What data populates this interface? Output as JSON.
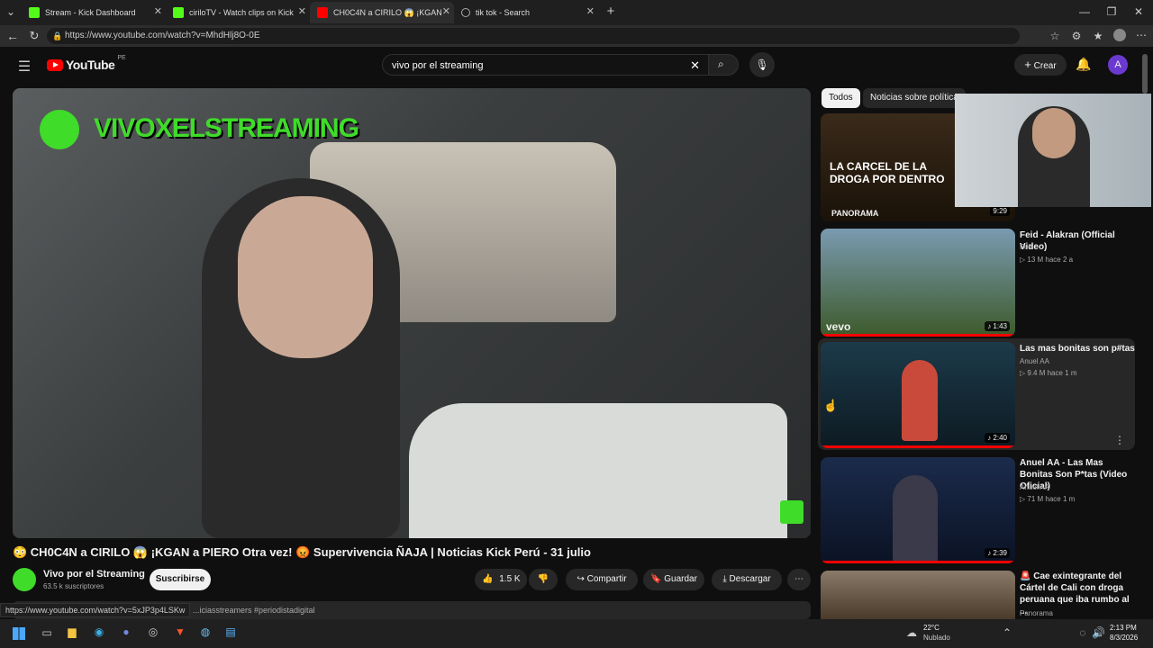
{
  "browser": {
    "tabs": [
      {
        "title": "Stream - Kick Dashboard"
      },
      {
        "title": "ciriloTV - Watch clips on Kick"
      },
      {
        "title": "CH0C4N a CIRILO 😱 ¡KGAN a"
      },
      {
        "title": "tik tok - Search"
      }
    ],
    "url": "https://www.youtube.com/watch?v=MhdHlj8O-0E",
    "status_url": "https://www.youtube.com/watch?v=5xJP3p4LSKw"
  },
  "yt": {
    "logo_text": "YouTube",
    "region": "PE",
    "search_value": "vivo por el streaming",
    "create_label": "Crear",
    "avatar_letter": "A"
  },
  "video": {
    "overlay_text": "VIVOXELSTREAMING",
    "title": "😳 CH0C4N a CIRILO 😱 ¡KGAN a PIERO Otra vez! 😡 Supervivencia ÑAJA | Noticias Kick Perú - 31 julio",
    "channel": "Vivo por el Streaming",
    "subscribers": "63.5 k suscriptores",
    "subscribe_label": "Suscribirse",
    "likes": "1.5 K",
    "share_label": "Compartir",
    "save_label": "Guardar",
    "download_label": "Descargar",
    "hashtags": "...iciasstreamers #periodistadigital"
  },
  "sidebar": {
    "chips": [
      "Todos",
      "Noticias sobre política"
    ],
    "items": [
      {
        "thumb_text": "LA CARCEL DE LA DROGA POR DENTRO",
        "brand": "PANORAMA",
        "duration": "9:29"
      },
      {
        "title": "Feid - Alakran (Official Video)",
        "channel": "Feid",
        "meta": "▷ 13 M  hace 2 a",
        "duration": "♪ 1:43",
        "brand": "vevo"
      },
      {
        "title": "Las mas bonitas son p#tas",
        "channel": "Anuel AA",
        "meta": "▷ 9.4 M  hace 1 m",
        "duration": "♪ 2:40"
      },
      {
        "title": "Anuel AA - Las Mas Bonitas Son P*tas (Video Oficial)",
        "channel": "Anuel AA",
        "meta": "▷ 71 M  hace 1 m",
        "duration": "♪ 2:39"
      },
      {
        "title": "🚨 Cae exintegrante del Cártel de Cali con droga peruana que iba rumbo al ...",
        "channel": "Panorama"
      }
    ]
  },
  "taskbar": {
    "weather_temp": "22°C",
    "weather_desc": "Nublado",
    "time": "2:13 PM",
    "date": "8/3/2026"
  }
}
